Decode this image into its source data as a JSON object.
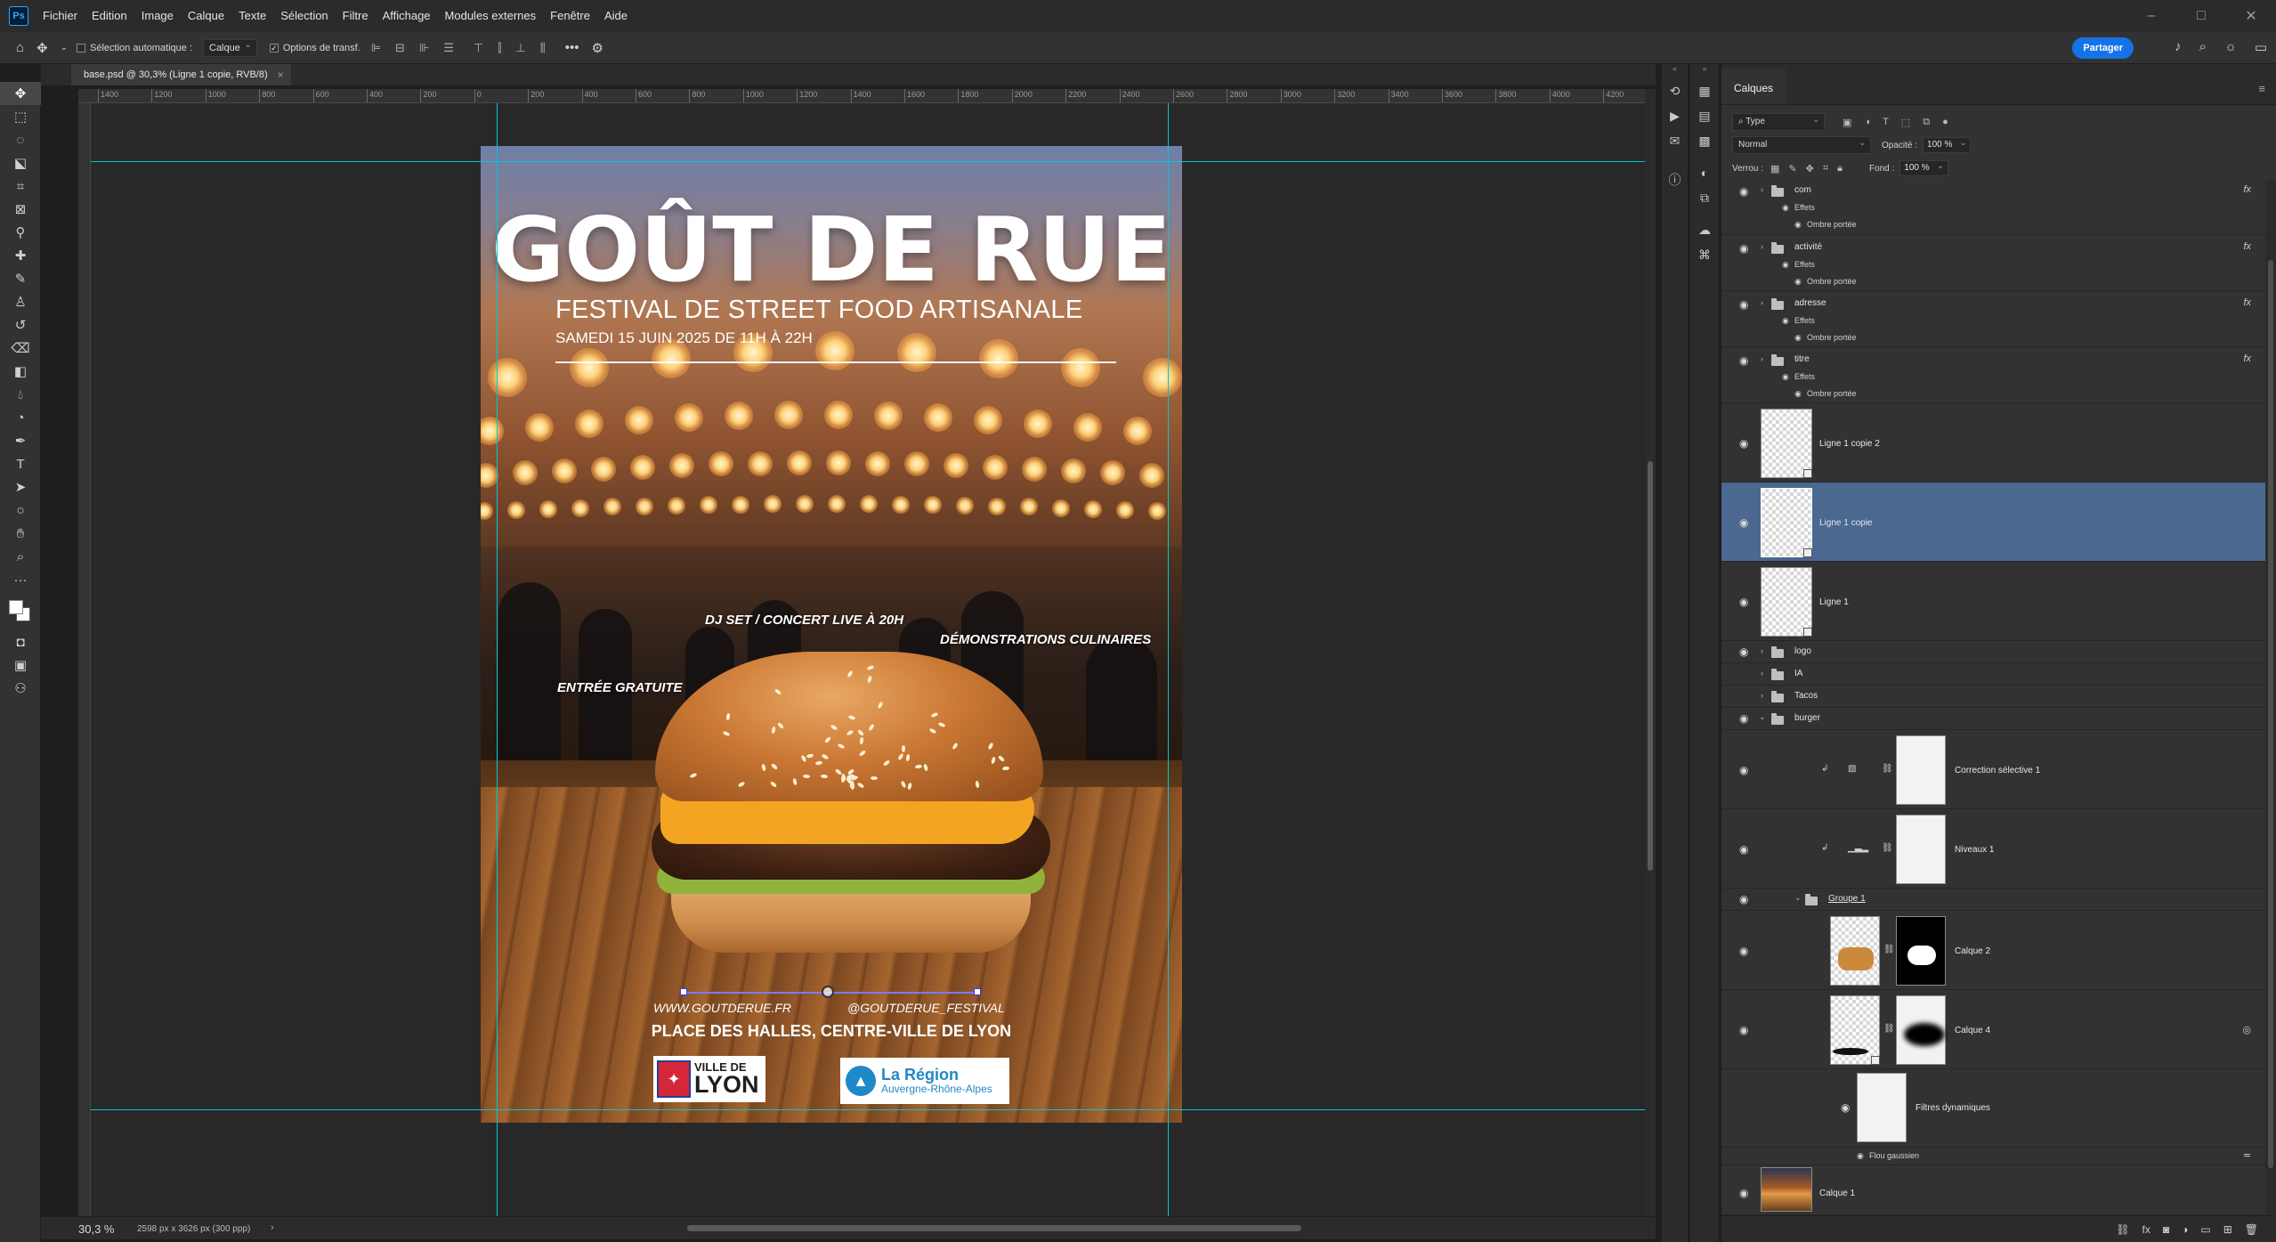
{
  "app": {
    "logo": "Ps"
  },
  "menu": [
    "Fichier",
    "Edition",
    "Image",
    "Calque",
    "Texte",
    "Sélection",
    "Filtre",
    "Affichage",
    "Modules externes",
    "Fenêtre",
    "Aide"
  ],
  "window_controls": {
    "minimize": "–",
    "maximize": "□",
    "close": "✕"
  },
  "options_bar": {
    "auto_select_label": "Sélection automatique :",
    "auto_select_checked": false,
    "auto_select_target": "Calque",
    "transform_label": "Options de transf.",
    "transform_checked": true,
    "more": "•••",
    "share_label": "Partager"
  },
  "document_tab": {
    "title": "base.psd @ 30,3% (Ligne 1 copie, RVB/8)",
    "close": "×"
  },
  "ruler_h_labels": [
    "1400",
    "1200",
    "1000",
    "800",
    "600",
    "400",
    "200",
    "0",
    "200",
    "400",
    "600",
    "800",
    "1000",
    "1200",
    "1400",
    "1600",
    "1800",
    "2000",
    "2200",
    "2400",
    "2600",
    "2800",
    "3000",
    "3200",
    "3400",
    "3600",
    "3800",
    "4000",
    "4200"
  ],
  "poster": {
    "title": "GOÛT DE RUE",
    "subtitle": "FESTIVAL DE STREET FOOD ARTISANALE",
    "date": "SAMEDI 15 JUIN 2025 DE 11H À 22H",
    "callout_concert": "DJ SET / CONCERT LIVE À 20H",
    "callout_demo": "DÉMONSTRATIONS CULINAIRES",
    "callout_free": "ENTRÉE GRATUITE",
    "website": "WWW.GOUTDERUE.FR",
    "social": "@GOUTDERUE_FESTIVAL",
    "address": "PLACE DES HALLES, CENTRE-VILLE DE LYON",
    "logo_lyon_line1": "VILLE DE",
    "logo_lyon_line2": "LYON",
    "logo_region_line1": "La Région",
    "logo_region_line2": "Auvergne-Rhône-Alpes"
  },
  "status": {
    "zoom": "30,3 %",
    "dimensions": "2598 px x 3626 px (300 ppp)",
    "arrow": "›"
  },
  "layers_panel": {
    "tab": "Calques",
    "filter_label": "Type",
    "blend_mode": "Normal",
    "opacity_label": "Opacité :",
    "opacity_value": "100 %",
    "lock_label": "Verrou :",
    "fill_label": "Fond :",
    "fill_value": "100 %",
    "effects_label": "Effets",
    "drop_shadow_label": "Ombre portée",
    "fx": "fx",
    "groups": {
      "com": "com",
      "activite": "activité",
      "adresse": "adresse",
      "titre": "titre",
      "logo": "logo",
      "ia": "IA",
      "tacos": "Tacos",
      "burger": "burger",
      "groupe1": "Groupe 1"
    },
    "layers": {
      "ligne1_copie2": "Ligne 1 copie 2",
      "ligne1_copie": "Ligne 1 copie",
      "ligne1": "Ligne 1",
      "correction": "Correction sélective 1",
      "niveaux": "Niveaux 1",
      "calque2": "Calque 2",
      "calque4": "Calque 4",
      "filtres": "Filtres dynamiques",
      "flou": "Flou gaussien",
      "calque1": "Calque 1"
    }
  }
}
